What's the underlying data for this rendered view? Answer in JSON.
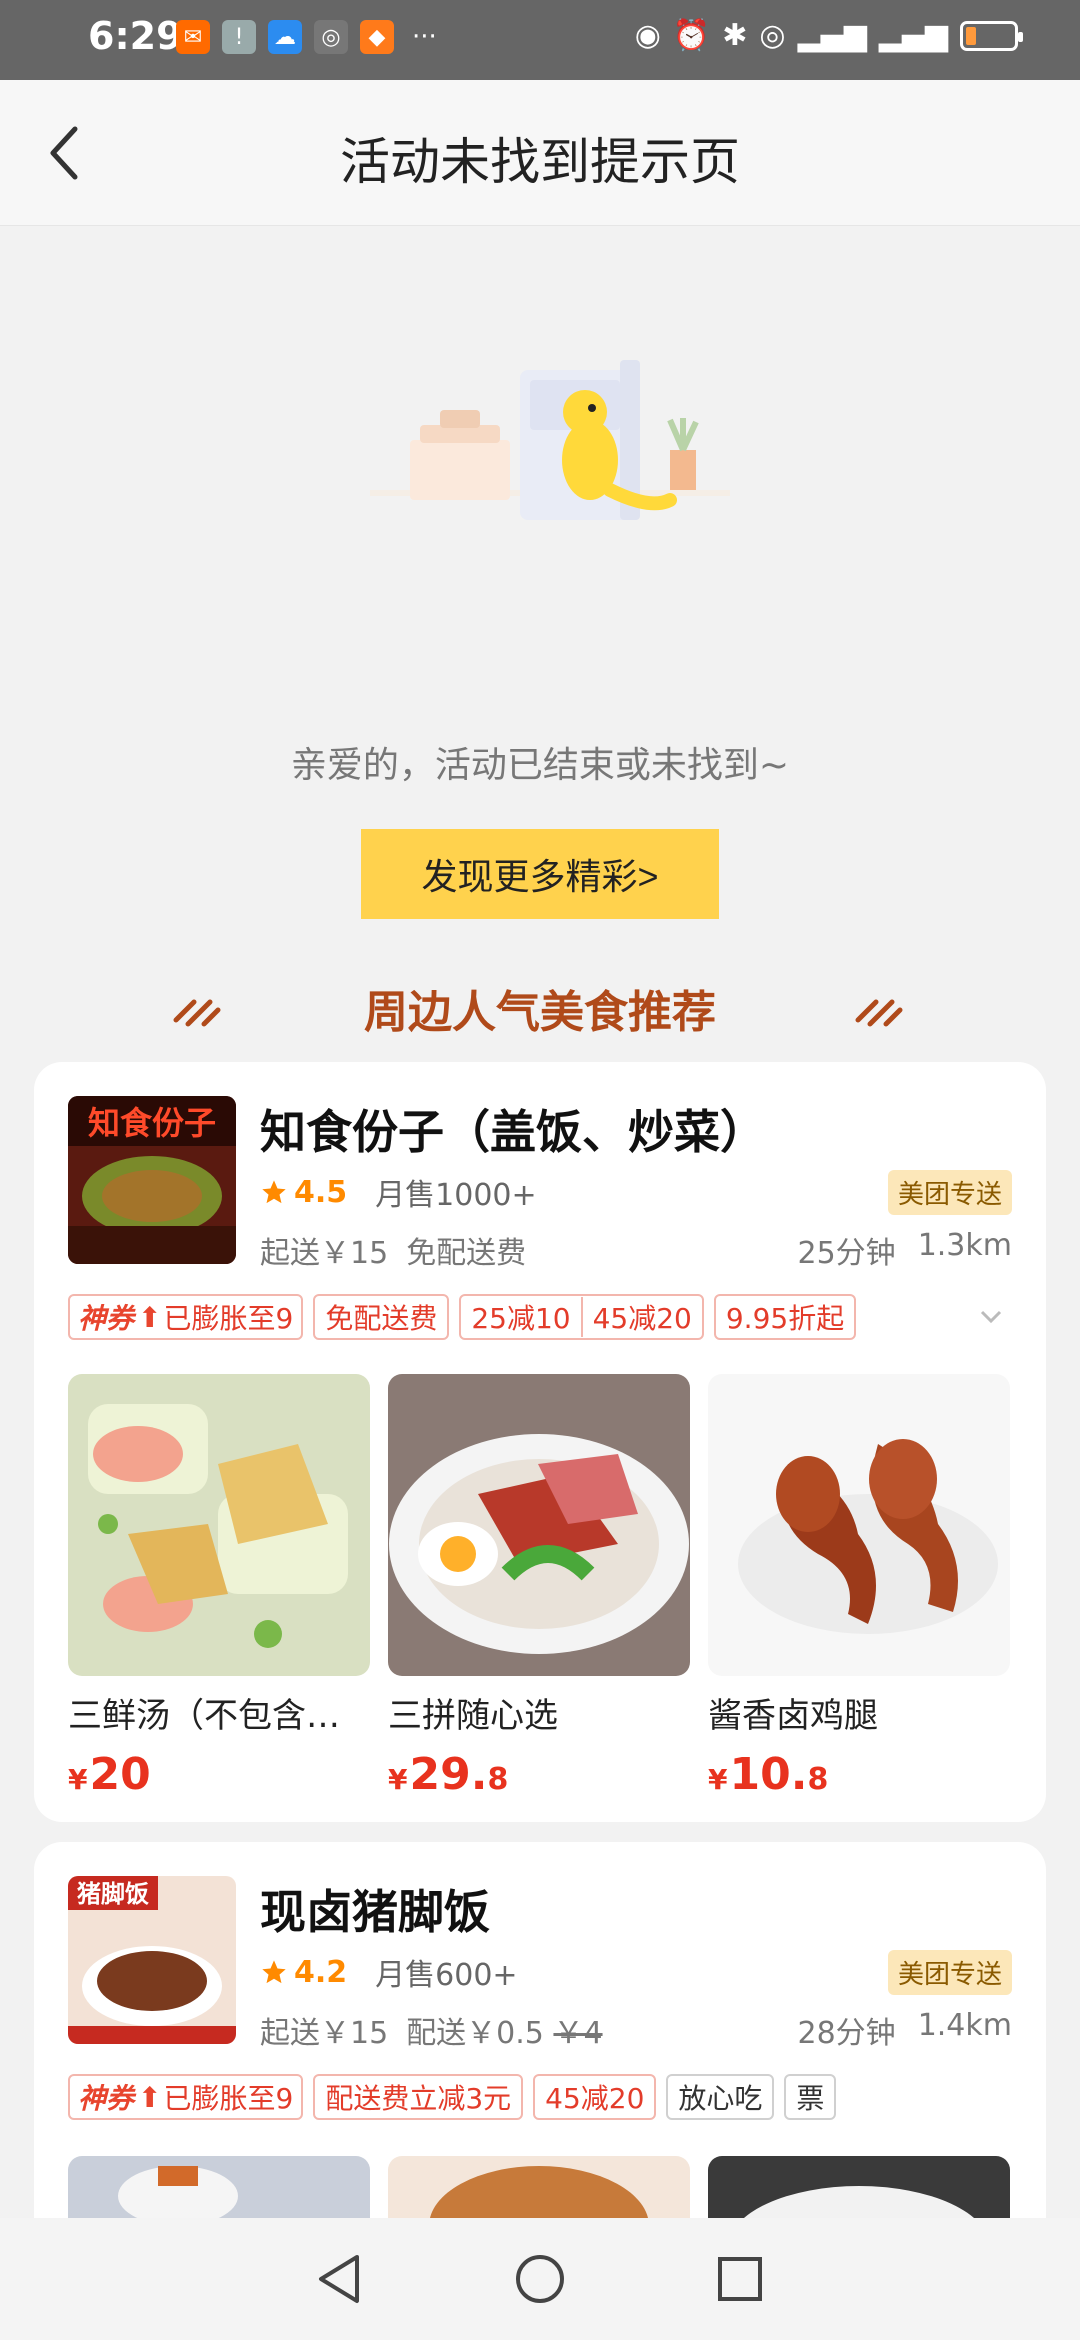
{
  "status_bar": {
    "time": "6:29"
  },
  "header": {
    "title": "活动未找到提示页"
  },
  "empty_state": {
    "message": "亲爱的，活动已结束或未找到~",
    "button_label": "发现更多精彩>"
  },
  "section": {
    "title": "周边人气美食推荐"
  },
  "shops": [
    {
      "name": "知食份子（盖饭、炒菜）",
      "rating": "4.5",
      "sales": "月售1000+",
      "badge": "美团专送",
      "min_order": "起送￥15",
      "delivery_fee": "免配送费",
      "time": "25分钟",
      "distance": "1.3km",
      "tags": {
        "super_prefix": "神券",
        "super_text": "已膨胀至9",
        "t1": "免配送费",
        "t2a": "25减10",
        "t2b": "45减20",
        "t3": "9.95折起"
      },
      "items": [
        {
          "name": "三鲜汤（不包含…",
          "currency": "¥",
          "price_int": "20",
          "price_dec": ""
        },
        {
          "name": "三拼随心选",
          "currency": "¥",
          "price_int": "29.",
          "price_dec": "8"
        },
        {
          "name": "酱香卤鸡腿",
          "currency": "¥",
          "price_int": "10.",
          "price_dec": "8"
        }
      ]
    },
    {
      "name": "现卤猪脚饭",
      "rating": "4.2",
      "sales": "月售600+",
      "badge": "美团专送",
      "min_order": "起送￥15",
      "delivery_fee": "配送￥0.5",
      "delivery_original": "￥4",
      "time": "28分钟",
      "distance": "1.4km",
      "tags": {
        "super_prefix": "神券",
        "super_text": "已膨胀至9",
        "t1": "配送费立减3元",
        "t2": "45减20",
        "t3": "放心吃",
        "t4": "票"
      }
    }
  ],
  "colors": {
    "accent": "#ffd24d",
    "price": "#e8321e",
    "rating": "#ff8a00"
  }
}
